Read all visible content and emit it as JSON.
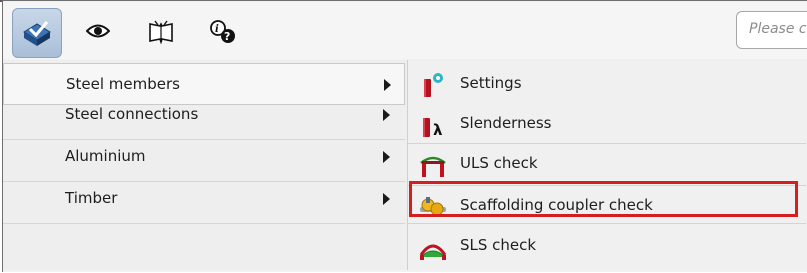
{
  "toolbar": {
    "buttons": [
      {
        "icon": "structure-check-icon",
        "active": true
      },
      {
        "icon": "eye-icon"
      },
      {
        "icon": "open-book-icon"
      },
      {
        "icon": "info-search-icon"
      }
    ],
    "search_placeholder": "Please ci"
  },
  "menu": {
    "items": [
      {
        "label": "Steel members"
      },
      {
        "label": "Steel connections"
      },
      {
        "label": "Aluminium"
      },
      {
        "label": "Timber"
      }
    ]
  },
  "submenu": {
    "items": [
      {
        "label": "Settings",
        "icon": "settings-member-icon"
      },
      {
        "label": "Slenderness",
        "icon": "slenderness-lambda-icon"
      },
      {
        "label": "ULS check",
        "icon": "uls-frame-icon"
      },
      {
        "label": "Scaffolding coupler check",
        "icon": "coupler-icon"
      },
      {
        "label": "SLS check",
        "icon": "sls-deflection-icon"
      }
    ]
  },
  "colors": {
    "highlight_border": "#d51f1f",
    "active_button": "#a9bfd8"
  }
}
